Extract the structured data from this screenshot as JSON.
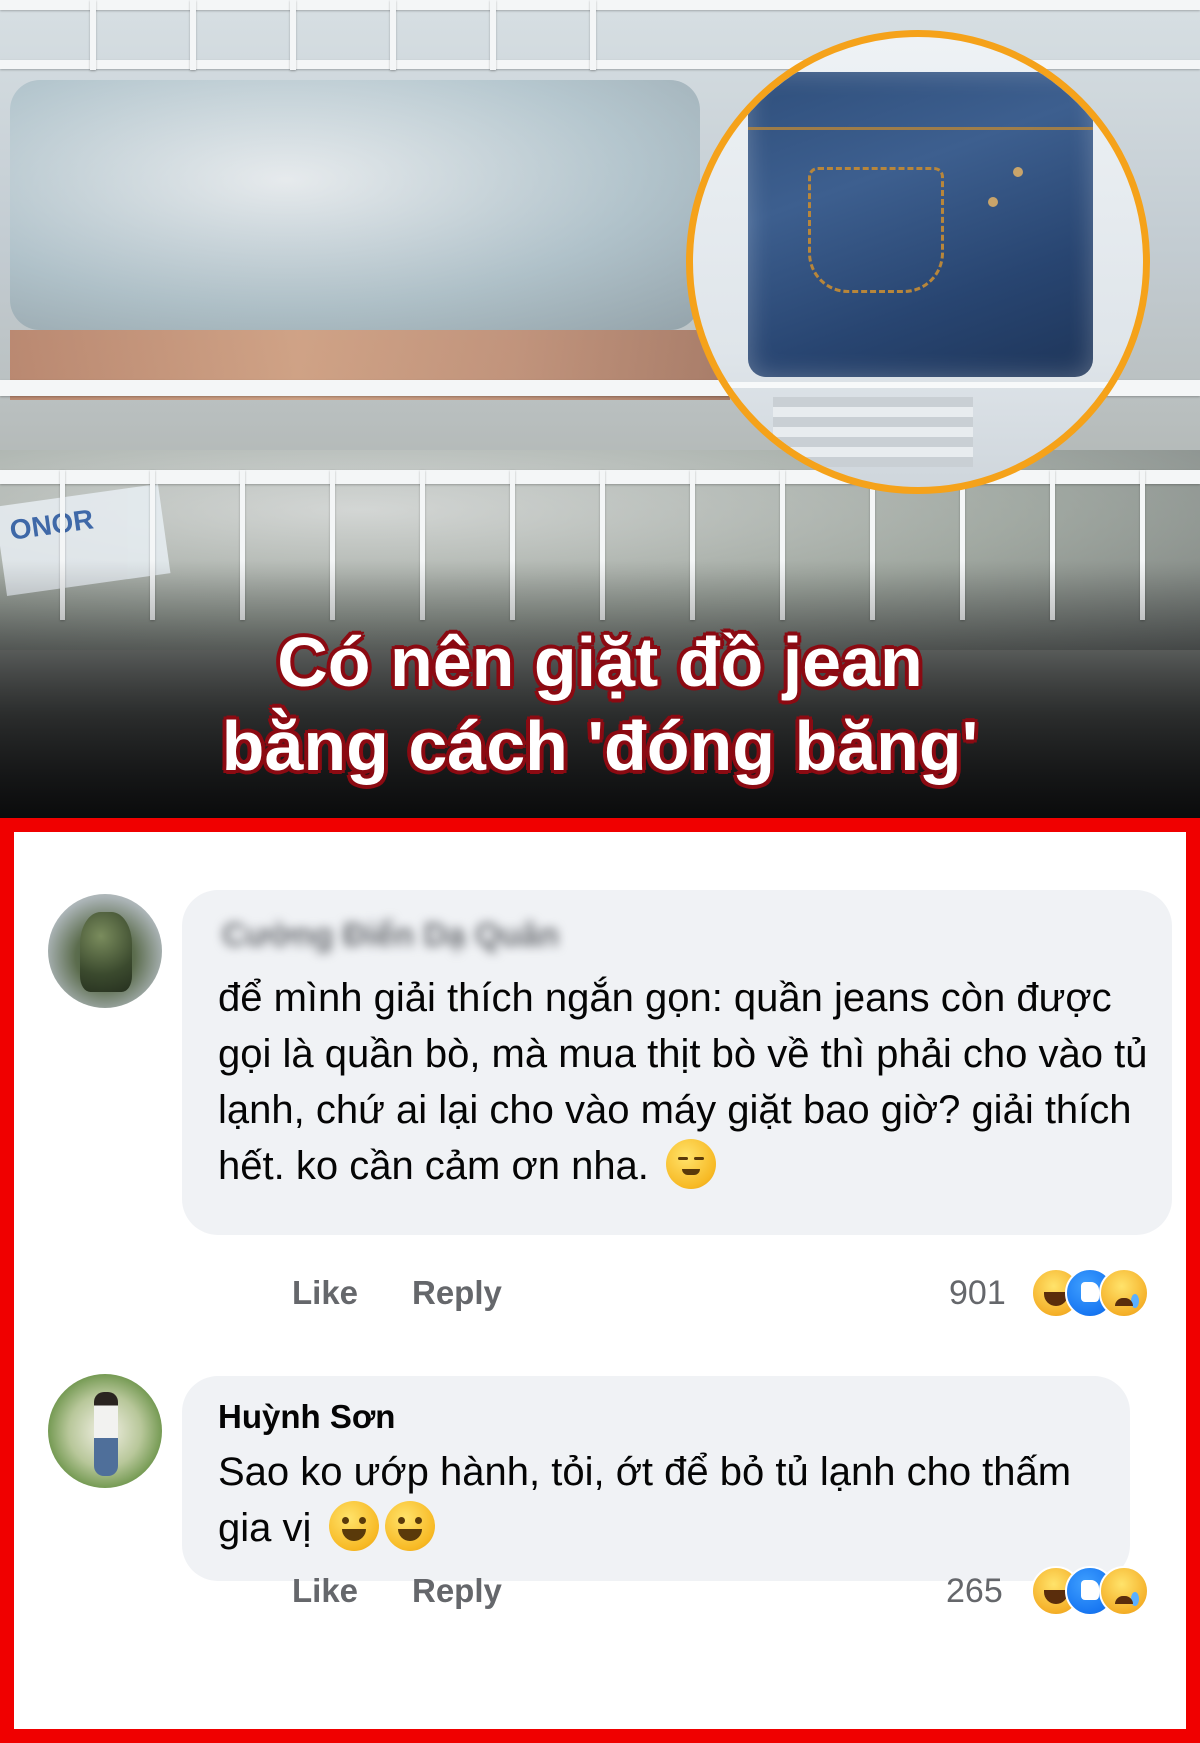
{
  "hero": {
    "headline_line1": "Có nên giặt đồ jean",
    "headline_line2": "bằng cách 'đóng băng'",
    "accent_color": "#f5a21a",
    "headline_stroke_color": "#8b0a12"
  },
  "panel": {
    "border_color": "#f00000"
  },
  "comments": [
    {
      "author": "Cường Điển Dạ Quân",
      "author_blurred": true,
      "text": "để mình giải thích ngắn gọn: quần jeans còn được gọi là quần bò, mà mua thịt bò về thì phải cho vào tủ lạnh, chứ ai lại cho vào máy giặt bao giờ? giải thích hết. ko cần cảm ơn nha.",
      "emoji": "smiling-face-icon",
      "like_label": "Like",
      "reply_label": "Reply",
      "reaction_count": "901",
      "reactions": [
        "haha-icon",
        "like-icon",
        "sad-icon"
      ]
    },
    {
      "author": "Huỳnh Sơn",
      "author_blurred": false,
      "text": "Sao ko ướp hành, tỏi, ớt để bỏ tủ lạnh cho thấm gia vị",
      "emoji": "grinning-face-icon",
      "like_label": "Like",
      "reply_label": "Reply",
      "reaction_count": "265",
      "reactions": [
        "haha-icon",
        "like-icon",
        "sad-icon"
      ]
    }
  ]
}
